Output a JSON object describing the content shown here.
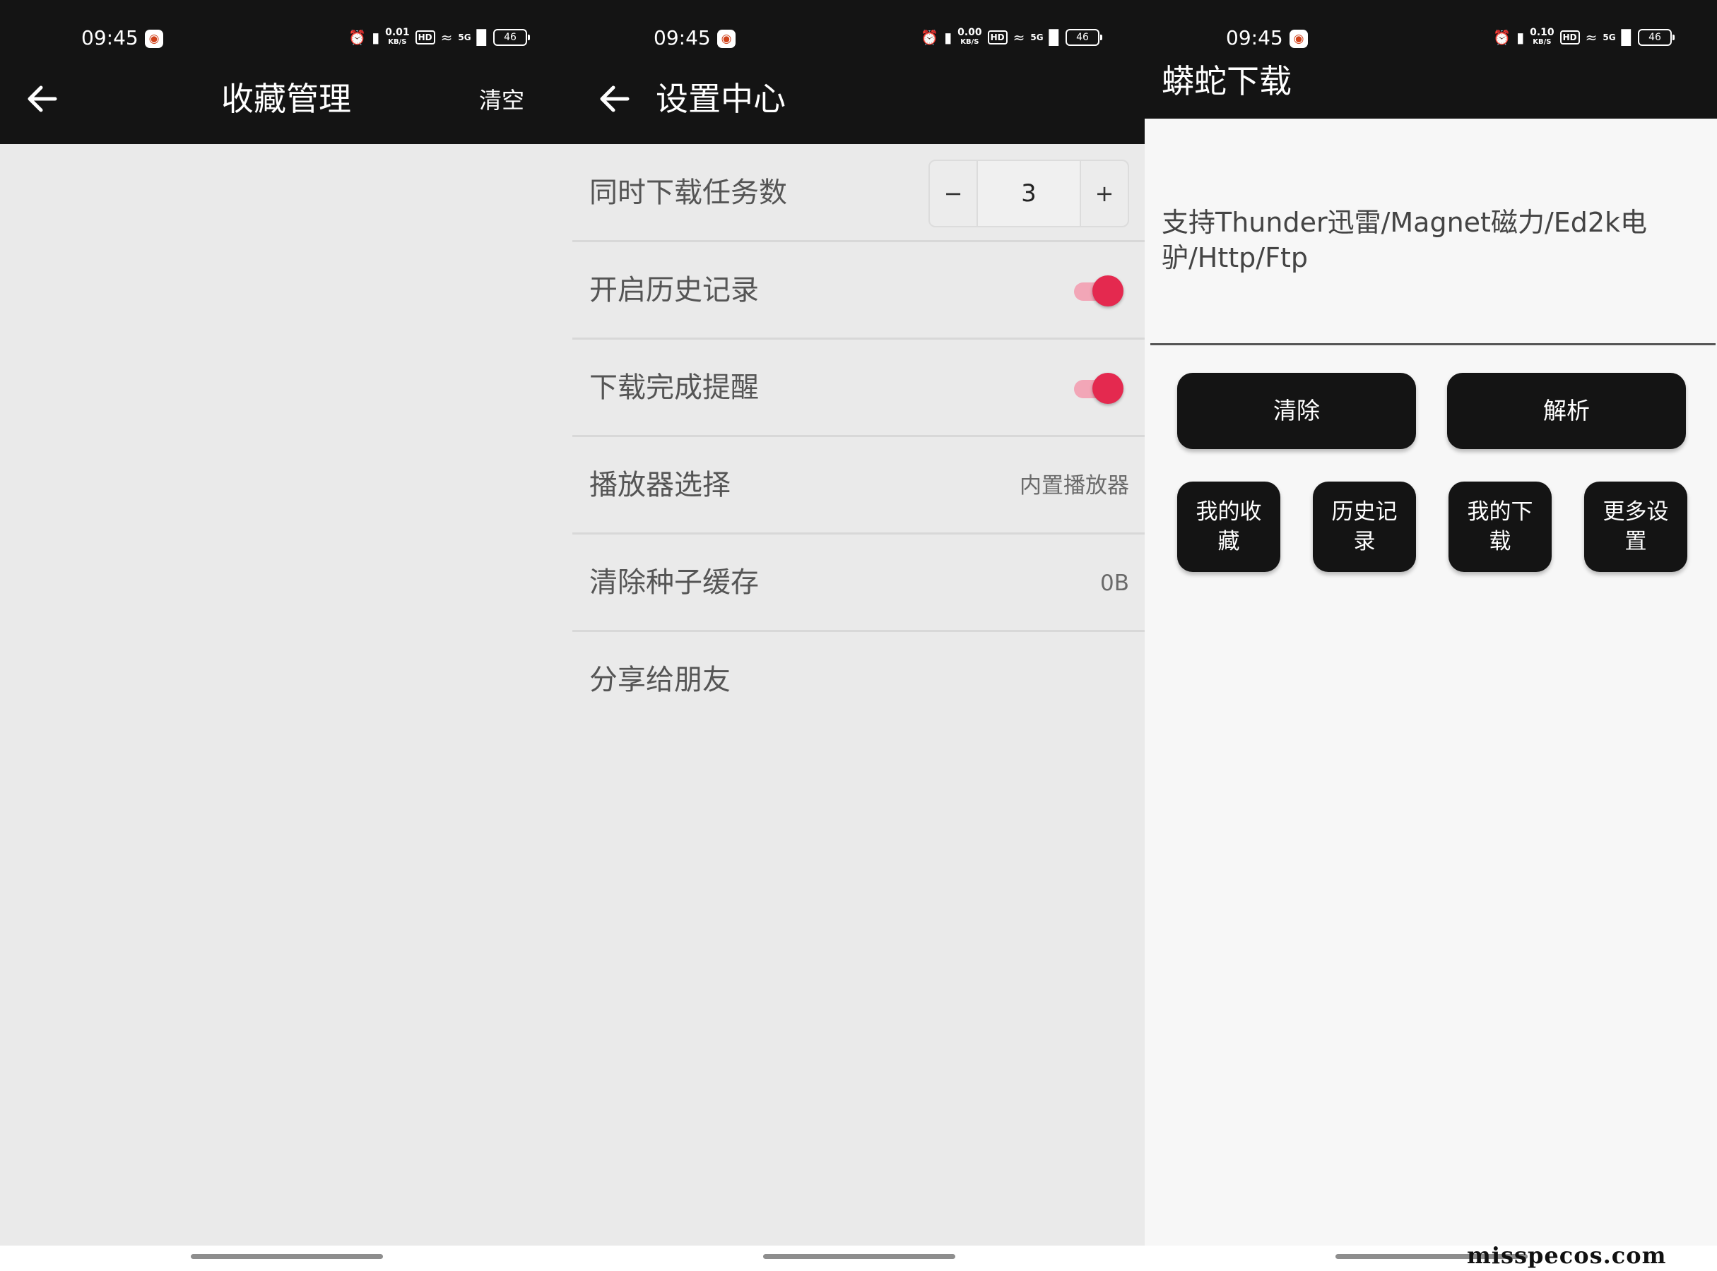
{
  "status_bar": {
    "time": "09:45",
    "notification_icon": "app-notification-icon",
    "alarm_icon": "alarm-icon",
    "vibrate_icon": "vibrate-icon",
    "speeds": [
      "0.01",
      "0.00",
      "0.10"
    ],
    "speed_unit": "KB/S",
    "hd_label": "HD",
    "network_label": "5G",
    "wifi_icon": "wifi-icon",
    "signal_icon": "signal-icon",
    "battery": "46"
  },
  "favorites_screen": {
    "title": "收藏管理",
    "clear_action": "清空",
    "back_icon": "back-arrow-icon"
  },
  "settings_screen": {
    "title": "设置中心",
    "back_icon": "back-arrow-icon",
    "rows": [
      {
        "label": "同时下载任务数",
        "type": "stepper",
        "minus": "−",
        "value": "3",
        "plus": "+"
      },
      {
        "label": "开启历史记录",
        "type": "toggle",
        "on": true
      },
      {
        "label": "下载完成提醒",
        "type": "toggle",
        "on": true
      },
      {
        "label": "播放器选择",
        "type": "value",
        "value": "内置播放器"
      },
      {
        "label": "清除种子缓存",
        "type": "value",
        "value": "0B"
      },
      {
        "label": "分享给朋友",
        "type": "none"
      }
    ],
    "toggle_color": "#e4294f"
  },
  "download_screen": {
    "title": "蟒蛇下载",
    "input_hint": "支持Thunder迅雷/Magnet磁力/Ed2k电驴/Http/Ftp",
    "clear_button": "清除",
    "parse_button": "解析",
    "nav_buttons": [
      "我的收藏",
      "历史记录",
      "我的下载",
      "更多设置"
    ]
  },
  "watermark": "misspecos.com",
  "colors": {
    "toolbar": "#141414",
    "settings_background": "#eaeaea",
    "accent": "#e4294f"
  }
}
